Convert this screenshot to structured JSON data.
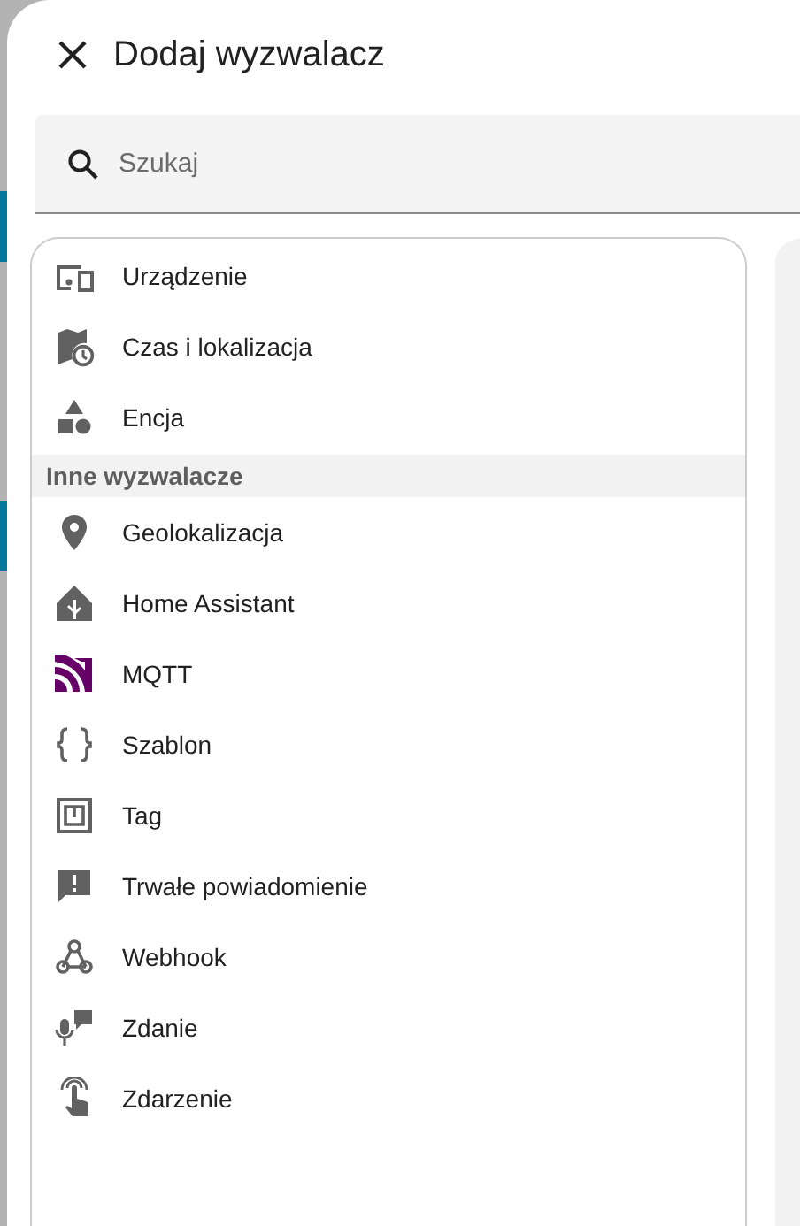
{
  "dialog": {
    "title": "Dodaj wyzwalacz"
  },
  "search": {
    "placeholder": "Szukaj"
  },
  "groups": [
    {
      "items": [
        {
          "label": "Urządzenie"
        },
        {
          "label": "Czas i lokalizacja"
        },
        {
          "label": "Encja"
        }
      ]
    },
    {
      "header": "Inne wyzwalacze",
      "items": [
        {
          "label": "Geolokalizacja"
        },
        {
          "label": "Home Assistant"
        },
        {
          "label": "MQTT"
        },
        {
          "label": "Szablon"
        },
        {
          "label": "Tag"
        },
        {
          "label": "Trwałe powiadomienie"
        },
        {
          "label": "Webhook"
        },
        {
          "label": "Zdanie"
        },
        {
          "label": "Zdarzenie"
        }
      ]
    }
  ]
}
